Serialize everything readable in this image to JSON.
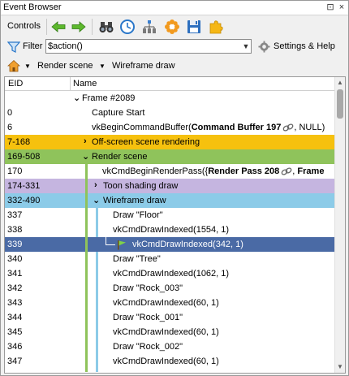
{
  "window": {
    "title": "Event Browser",
    "pin_glyph": "⊡",
    "close_glyph": "×"
  },
  "toolbar": {
    "label": "Controls",
    "icons": [
      "arrow-left-icon",
      "arrow-right-icon",
      "binoculars-icon",
      "clock-icon",
      "tree-hierarchy-icon",
      "gear-flower-icon",
      "save-disk-icon",
      "puzzle-icon"
    ]
  },
  "filter": {
    "label": "Filter",
    "value": "$action()",
    "settings_label": "Settings & Help"
  },
  "breadcrumbs": {
    "home_arrow": "▼",
    "items": [
      "Render scene",
      "Wireframe draw"
    ],
    "sep": "▼"
  },
  "tree": {
    "headers": {
      "eid": "EID",
      "name": "Name"
    },
    "rows": [
      {
        "eid": "",
        "name": "Frame #2089",
        "chev": "v"
      },
      {
        "eid": "0",
        "name": "Capture Start"
      },
      {
        "eid": "6",
        "name": "vkBeginCommandBuffer(",
        "bold": "Command Buffer 197",
        "tail": ", NULL)"
      },
      {
        "eid": "7-168",
        "name": "Off-screen scene rendering",
        "chev": ">"
      },
      {
        "eid": "169-508",
        "name": "Render scene",
        "chev": "v"
      },
      {
        "eid": "170",
        "name": "vkCmdBeginRenderPass({",
        "bold": "Render Pass 208",
        "tail2": ",",
        "bold2": "Frame"
      },
      {
        "eid": "174-331",
        "name": "Toon shading draw",
        "chev": ">"
      },
      {
        "eid": "332-490",
        "name": "Wireframe draw",
        "chev": "v"
      },
      {
        "eid": "337",
        "name": "Draw \"Floor\""
      },
      {
        "eid": "338",
        "name": "vkCmdDrawIndexed(1554, 1)"
      },
      {
        "eid": "339",
        "name": "vkCmdDrawIndexed(342, 1)"
      },
      {
        "eid": "340",
        "name": "Draw \"Tree\""
      },
      {
        "eid": "341",
        "name": "vkCmdDrawIndexed(1062, 1)"
      },
      {
        "eid": "342",
        "name": "Draw \"Rock_003\""
      },
      {
        "eid": "343",
        "name": "vkCmdDrawIndexed(60, 1)"
      },
      {
        "eid": "344",
        "name": "Draw \"Rock_001\""
      },
      {
        "eid": "345",
        "name": "vkCmdDrawIndexed(60, 1)"
      },
      {
        "eid": "346",
        "name": "Draw \"Rock_002\""
      },
      {
        "eid": "347",
        "name": "vkCmdDrawIndexed(60, 1)"
      }
    ]
  },
  "colors": {
    "offscreen": "#f6c10e",
    "render_scene": "#8fc35b",
    "toon": "#c5b5e0",
    "wireframe": "#8ccbe8",
    "selected": "#4a6aa5"
  }
}
